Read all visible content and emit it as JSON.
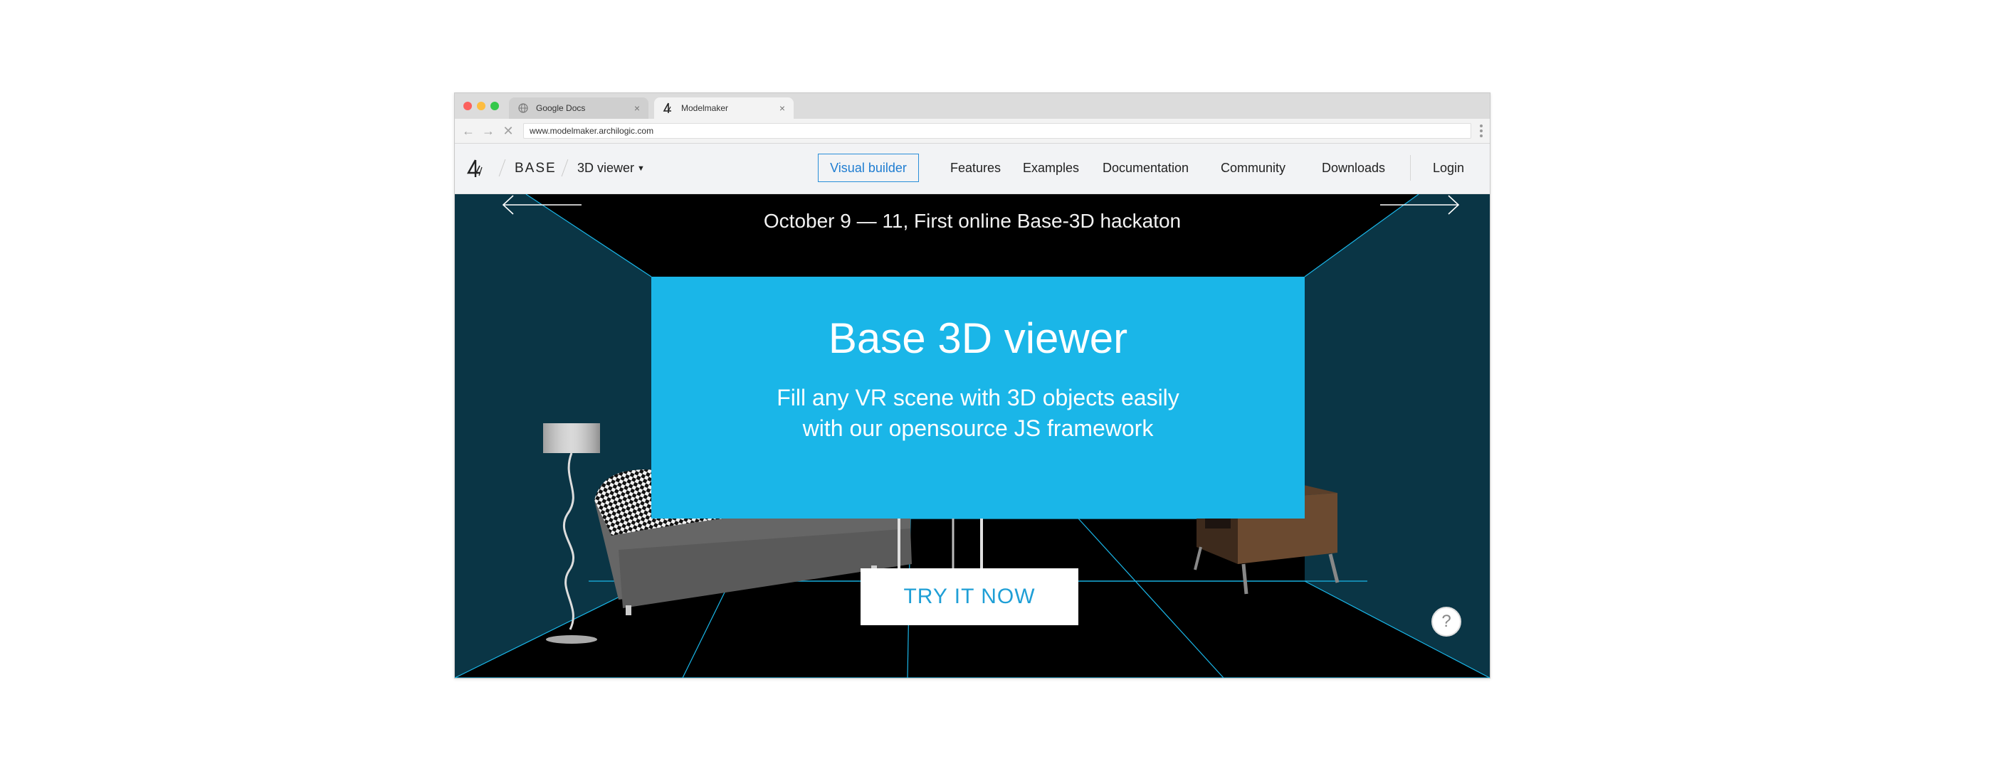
{
  "browser": {
    "tabs": [
      {
        "label": "Google Docs",
        "icon": "globe-icon"
      },
      {
        "label": "Modelmaker",
        "icon": "archilogic-logo-icon"
      }
    ],
    "close_glyph": "×",
    "url": "www.modelmaker.archilogic.com"
  },
  "nav": {
    "brand": "BASE",
    "section": "3D viewer",
    "visual_builder": "Visual builder",
    "links": [
      "Features",
      "Examples",
      "Documentation",
      "Community",
      "Downloads"
    ],
    "login": "Login"
  },
  "hero": {
    "banner": "October 9 — 11, First online Base-3D hackaton",
    "title": "Base 3D viewer",
    "subtitle_line1": "Fill any VR scene with 3D objects easily",
    "subtitle_line2": "with our opensource JS framework",
    "cta": "TRY IT NOW",
    "help": "?"
  },
  "colors": {
    "accent": "#1ab6e8",
    "side_wall": "#0a3545",
    "grid_line": "#1ab6e8",
    "button_outline": "#2a8ed8"
  }
}
